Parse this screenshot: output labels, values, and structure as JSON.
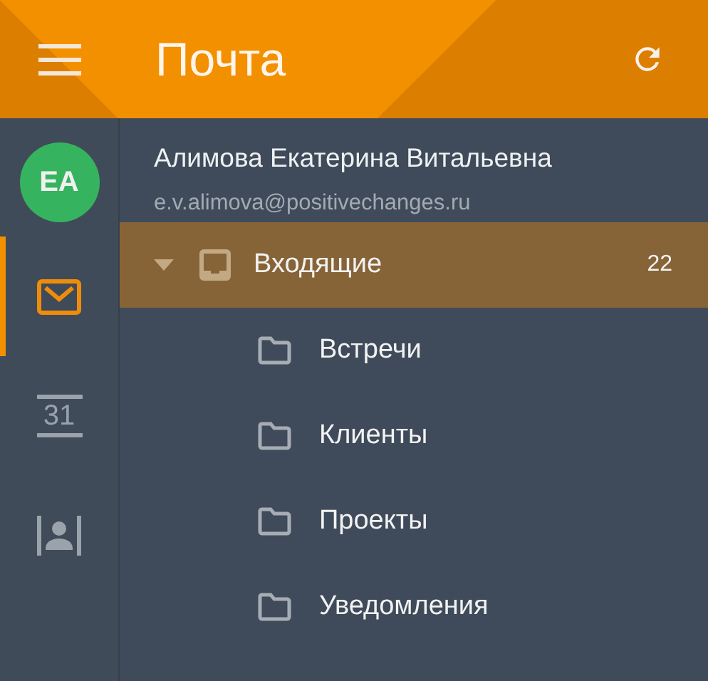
{
  "header": {
    "title": "Почта"
  },
  "rail": {
    "avatar": {
      "initials": "EA",
      "color": "#36b35e"
    },
    "items": [
      {
        "kind": "mail",
        "selected": true
      },
      {
        "kind": "calendar",
        "text": "31",
        "selected": false
      },
      {
        "kind": "contacts",
        "selected": false
      }
    ]
  },
  "account": {
    "name": "Алимова Екатерина Витальевна",
    "email": "e.v.alimova@positivechanges.ru"
  },
  "folders": [
    {
      "kind": "inbox",
      "label": "Входящие",
      "count": "22",
      "expanded": true,
      "selected": true,
      "children": [
        {
          "kind": "folder",
          "label": "Встречи",
          "selected": false
        },
        {
          "kind": "folder",
          "label": "Клиенты",
          "selected": false
        },
        {
          "kind": "folder",
          "label": "Проекты",
          "selected": false
        },
        {
          "kind": "folder",
          "label": "Уведомления",
          "selected": false
        }
      ]
    }
  ]
}
